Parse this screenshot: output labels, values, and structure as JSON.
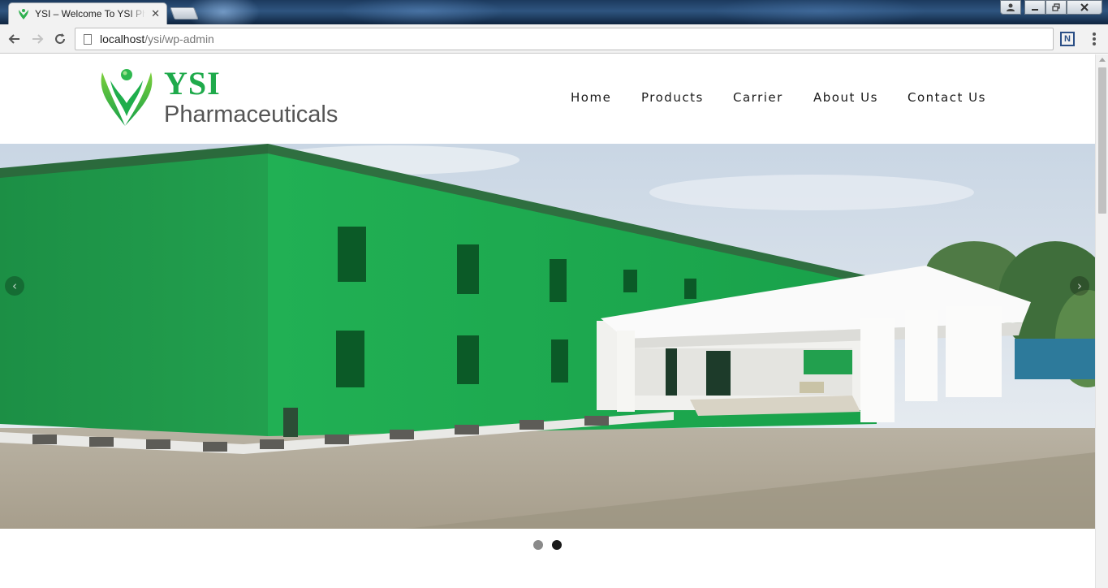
{
  "browser": {
    "tab_title": "YSI – Welcome To YSI Pharmaceuticals",
    "tab_close": "✕",
    "url_host": "localhost",
    "url_path": "/ysi/wp-admin",
    "extension_icon": "N"
  },
  "site": {
    "logo_title": "YSI",
    "logo_subtitle": "Pharmaceuticals",
    "brand_color": "#1faa4b"
  },
  "nav": {
    "items": [
      {
        "label": "Home"
      },
      {
        "label": "Products"
      },
      {
        "label": "Carrier"
      },
      {
        "label": "About Us"
      },
      {
        "label": "Contact Us"
      }
    ]
  },
  "slider": {
    "prev_icon": "‹",
    "next_icon": "›",
    "slide_count": 2,
    "active_slide": 2
  }
}
